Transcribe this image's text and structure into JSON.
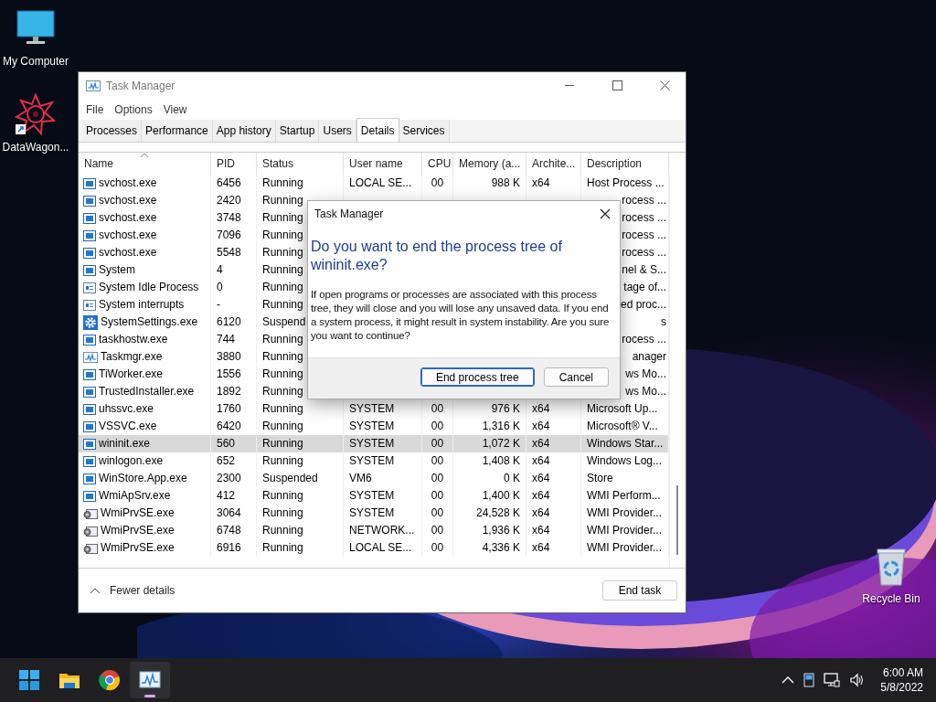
{
  "desktop_icons": [
    {
      "label": "My Computer",
      "kind": "computer"
    },
    {
      "label": "DataWagon...",
      "kind": "shortcut"
    },
    {
      "label": "Recycle Bin",
      "kind": "bin"
    }
  ],
  "window": {
    "title": "Task Manager",
    "menu": [
      "File",
      "Options",
      "View"
    ],
    "tabs": [
      {
        "label": "Processes",
        "selected": false
      },
      {
        "label": "Performance",
        "selected": false
      },
      {
        "label": "App history",
        "selected": false
      },
      {
        "label": "Startup",
        "selected": false
      },
      {
        "label": "Users",
        "selected": false
      },
      {
        "label": "Details",
        "selected": true
      },
      {
        "label": "Services",
        "selected": false
      }
    ],
    "columns": [
      {
        "label": "Name",
        "sorted": true
      },
      {
        "label": "PID",
        "sorted": false
      },
      {
        "label": "Status",
        "sorted": false
      },
      {
        "label": "User name",
        "sorted": false
      },
      {
        "label": "CPU",
        "sorted": false
      },
      {
        "label": "Memory (a...",
        "sorted": false
      },
      {
        "label": "Archite...",
        "sorted": false
      },
      {
        "label": "Description",
        "sorted": false
      }
    ],
    "rows": [
      {
        "kind": "service",
        "name": "svchost.exe",
        "pid": "6456",
        "status": "Running",
        "user": "LOCAL SE...",
        "cpu": "00",
        "memory": "988 K",
        "arch": "x64",
        "description": "Host Process ...",
        "selected": false
      },
      {
        "kind": "service",
        "name": "svchost.exe",
        "pid": "2420",
        "status": "Running",
        "description_tail": "rocess ...",
        "selected": false
      },
      {
        "kind": "service",
        "name": "svchost.exe",
        "pid": "3748",
        "status": "Running",
        "description_tail": "rocess ...",
        "selected": false
      },
      {
        "kind": "service",
        "name": "svchost.exe",
        "pid": "7096",
        "status": "Running",
        "description_tail": "rocess ...",
        "selected": false
      },
      {
        "kind": "service",
        "name": "svchost.exe",
        "pid": "5548",
        "status": "Running",
        "description_tail": "rocess ...",
        "selected": false
      },
      {
        "kind": "service",
        "name": "System",
        "pid": "4",
        "status": "Running",
        "description_tail": "nel & S...",
        "selected": false
      },
      {
        "kind": "plain",
        "name": "System Idle Process",
        "pid": "0",
        "status": "Running",
        "description_tail": "tage of...",
        "selected": false
      },
      {
        "kind": "plain",
        "name": "System interrupts",
        "pid": "-",
        "status": "Running",
        "description_tail": "ed proc...",
        "selected": false
      },
      {
        "kind": "settings",
        "name": "SystemSettings.exe",
        "pid": "6120",
        "status": "Suspend",
        "description_tail": "s",
        "selected": false
      },
      {
        "kind": "service",
        "name": "taskhostw.exe",
        "pid": "744",
        "status": "Running",
        "description_tail": "rocess ...",
        "selected": false
      },
      {
        "kind": "monitor",
        "name": "Taskmgr.exe",
        "pid": "3880",
        "status": "Running",
        "description_tail": "anager",
        "selected": false
      },
      {
        "kind": "service",
        "name": "TiWorker.exe",
        "pid": "1556",
        "status": "Running",
        "description_tail": "ws Mo...",
        "selected": false
      },
      {
        "kind": "service",
        "name": "TrustedInstaller.exe",
        "pid": "1892",
        "status": "Running",
        "description_tail": "ws Mo...",
        "selected": false
      },
      {
        "kind": "service",
        "name": "uhssvc.exe",
        "pid": "1760",
        "status": "Running",
        "user": "SYSTEM",
        "cpu": "00",
        "memory": "976 K",
        "arch": "x64",
        "description": "Microsoft Up...",
        "selected": false
      },
      {
        "kind": "service",
        "name": "VSSVC.exe",
        "pid": "6420",
        "status": "Running",
        "user": "SYSTEM",
        "cpu": "00",
        "memory": "1,316 K",
        "arch": "x64",
        "description": "Microsoft® V...",
        "selected": false
      },
      {
        "kind": "service",
        "name": "wininit.exe",
        "pid": "560",
        "status": "Running",
        "user": "SYSTEM",
        "cpu": "00",
        "memory": "1,072 K",
        "arch": "x64",
        "description": "Windows Star...",
        "selected": true
      },
      {
        "kind": "service",
        "name": "winlogon.exe",
        "pid": "652",
        "status": "Running",
        "user": "SYSTEM",
        "cpu": "00",
        "memory": "1,408 K",
        "arch": "x64",
        "description": "Windows Log...",
        "selected": false
      },
      {
        "kind": "service",
        "name": "WinStore.App.exe",
        "pid": "2300",
        "status": "Suspended",
        "user": "VM6",
        "cpu": "00",
        "memory": "0 K",
        "arch": "x64",
        "description": "Store",
        "selected": false
      },
      {
        "kind": "service",
        "name": "WmiApSrv.exe",
        "pid": "412",
        "status": "Running",
        "user": "SYSTEM",
        "cpu": "00",
        "memory": "1,400 K",
        "arch": "x64",
        "description": "WMI Perform...",
        "selected": false
      },
      {
        "kind": "provider",
        "name": "WmiPrvSE.exe",
        "pid": "3064",
        "status": "Running",
        "user": "SYSTEM",
        "cpu": "00",
        "memory": "24,528 K",
        "arch": "x64",
        "description": "WMI Provider...",
        "selected": false
      },
      {
        "kind": "provider",
        "name": "WmiPrvSE.exe",
        "pid": "6748",
        "status": "Running",
        "user": "NETWORK...",
        "cpu": "00",
        "memory": "1,936 K",
        "arch": "x64",
        "description": "WMI Provider...",
        "selected": false
      },
      {
        "kind": "provider",
        "name": "WmiPrvSE.exe",
        "pid": "6916",
        "status": "Running",
        "user": "LOCAL SE...",
        "cpu": "00",
        "memory": "4,336 K",
        "arch": "x64",
        "description": "WMI Provider...",
        "selected": false
      }
    ],
    "footer": {
      "toggle": "Fewer details",
      "button": "End task"
    }
  },
  "dialog": {
    "title": "Task Manager",
    "heading": "Do you want to end the process tree of wininit.exe?",
    "message": "If open programs or processes are associated with this process tree, they will close and you will lose any unsaved data. If you end a system process, it might result in system instability. Are you sure you want to continue?",
    "buttons": [
      {
        "label": "End process tree",
        "selected": true
      },
      {
        "label": "Cancel",
        "selected": false
      }
    ]
  },
  "taskbar": {
    "apps": [
      {
        "kind": "start",
        "selected": false
      },
      {
        "kind": "folder",
        "selected": false
      },
      {
        "kind": "browser",
        "selected": false
      },
      {
        "kind": "monitor",
        "selected": true
      }
    ],
    "time": "6:00 AM",
    "date": "5/8/2022"
  }
}
